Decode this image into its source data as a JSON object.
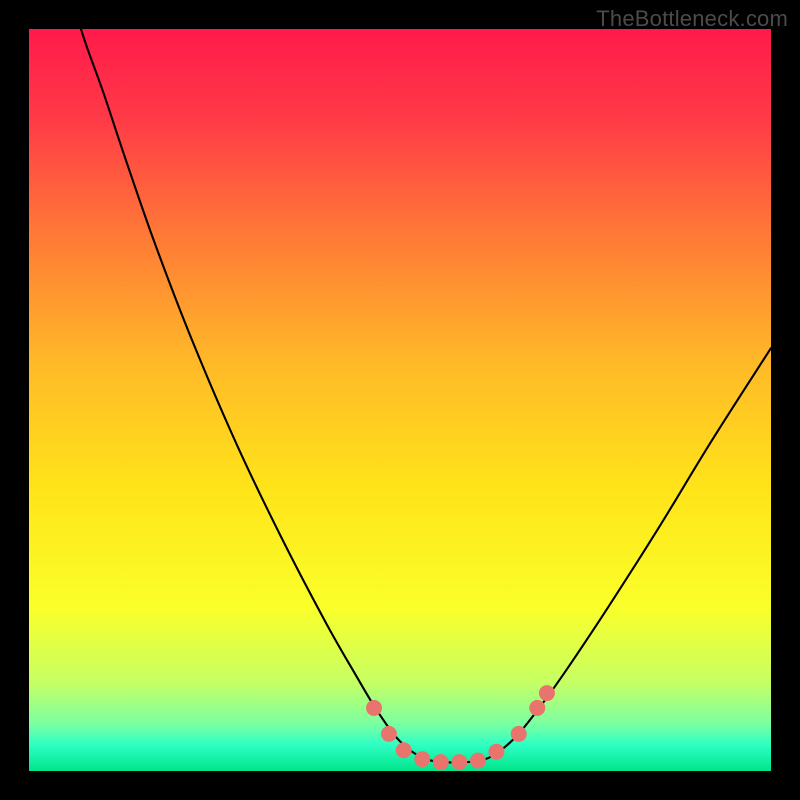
{
  "attribution": "TheBottleneck.com",
  "chart_data": {
    "type": "line",
    "title": "",
    "xlabel": "",
    "ylabel": "",
    "xlim": [
      0,
      100
    ],
    "ylim": [
      0,
      100
    ],
    "background_gradient": {
      "stops": [
        {
          "offset": 0.0,
          "color": "#ff1a4b"
        },
        {
          "offset": 0.12,
          "color": "#ff3a47"
        },
        {
          "offset": 0.28,
          "color": "#ff7a36"
        },
        {
          "offset": 0.45,
          "color": "#ffb928"
        },
        {
          "offset": 0.62,
          "color": "#ffe419"
        },
        {
          "offset": 0.78,
          "color": "#faff2a"
        },
        {
          "offset": 0.88,
          "color": "#c6ff63"
        },
        {
          "offset": 0.935,
          "color": "#7effa0"
        },
        {
          "offset": 0.965,
          "color": "#2effc4"
        },
        {
          "offset": 1.0,
          "color": "#00e58a"
        }
      ]
    },
    "series": [
      {
        "name": "bottleneck-curve",
        "stroke": "#000000",
        "stroke_width": 2.1,
        "points": [
          {
            "x": 7.0,
            "y": 100.0
          },
          {
            "x": 8.0,
            "y": 97.0
          },
          {
            "x": 10.0,
            "y": 91.5
          },
          {
            "x": 13.0,
            "y": 82.5
          },
          {
            "x": 17.0,
            "y": 71.0
          },
          {
            "x": 22.0,
            "y": 58.0
          },
          {
            "x": 28.0,
            "y": 44.0
          },
          {
            "x": 34.0,
            "y": 31.5
          },
          {
            "x": 40.0,
            "y": 20.0
          },
          {
            "x": 44.0,
            "y": 13.0
          },
          {
            "x": 47.0,
            "y": 8.0
          },
          {
            "x": 50.0,
            "y": 4.0
          },
          {
            "x": 53.0,
            "y": 1.8
          },
          {
            "x": 56.0,
            "y": 1.2
          },
          {
            "x": 59.0,
            "y": 1.2
          },
          {
            "x": 62.0,
            "y": 1.8
          },
          {
            "x": 65.0,
            "y": 4.0
          },
          {
            "x": 68.0,
            "y": 7.5
          },
          {
            "x": 72.0,
            "y": 13.0
          },
          {
            "x": 78.0,
            "y": 22.0
          },
          {
            "x": 85.0,
            "y": 33.0
          },
          {
            "x": 92.0,
            "y": 44.5
          },
          {
            "x": 100.0,
            "y": 57.0
          }
        ]
      }
    ],
    "markers": {
      "color": "#e9746d",
      "radius_px": 8,
      "points": [
        {
          "x": 46.5,
          "y": 8.5
        },
        {
          "x": 48.5,
          "y": 5.0
        },
        {
          "x": 50.5,
          "y": 2.8
        },
        {
          "x": 53.0,
          "y": 1.6
        },
        {
          "x": 55.5,
          "y": 1.2
        },
        {
          "x": 58.0,
          "y": 1.2
        },
        {
          "x": 60.5,
          "y": 1.4
        },
        {
          "x": 63.0,
          "y": 2.6
        },
        {
          "x": 66.0,
          "y": 5.0
        },
        {
          "x": 68.5,
          "y": 8.5
        },
        {
          "x": 69.8,
          "y": 10.5
        }
      ]
    }
  }
}
